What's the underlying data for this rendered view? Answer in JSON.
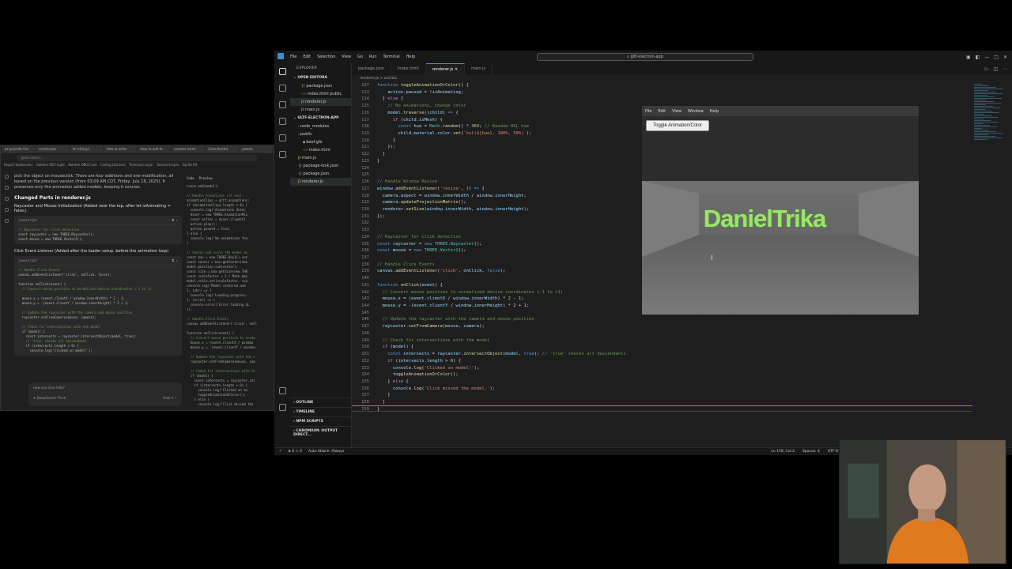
{
  "browser": {
    "tabs": [
      "pt-(p)cklab Cre",
      "constructor",
      "ltc-o(fo)(p)",
      "How to write",
      "How to add th",
      "useeter to(lo)",
      "Calendar(fo)",
      "pwerlo"
    ],
    "url": "grok.com/c/...",
    "bookmarks": [
      "Import bookmarks",
      "Ableton DEV Light",
      "Ableton DBG2 Inst",
      "Coding Libraries",
      "Technical Layer",
      "Tutorial Inspec",
      "Sprite Kit"
    ]
  },
  "chat": {
    "intro": "pick the object on mouseclick. There are four additions and one modification, all based on the previous version (from 03:09 AM CDT, Friday, July 18, 2025). It preserves only the animation added models, keeping it concise.",
    "heading": "Changed Parts in renderer.js",
    "bullet1": "Raycaster and Mouse Initialization (Added near the top, after let isAnimating = false;)",
    "code1_lang": "javascript",
    "code1_lines": [
      "// Raycaster for click detection",
      "const raycaster = new THREE.Raycaster();",
      "const mouse = new THREE.Vector2();"
    ],
    "bullet2": "Click Event Listener (Added after the loader setup, before the animation loop)",
    "code2_lang": "javascript",
    "code2_lines": [
      "// Handle Click Events",
      "canvas.addEventListener('click', onClick, false);",
      "",
      "function onClick(event) {",
      "  // Convert mouse position to normalized device coordinates (-1 to 1)",
      "",
      "  mouse.x = (event.clientX / window.innerWidth) * 2 - 1;",
      "  mouse.y = -(event.clientY / window.innerHeight) * 2 + 1;",
      "",
      "  // Update the raycaster with the camera and mouse position",
      "  raycaster.setFromCamera(mouse, camera);",
      "",
      "  // Check for intersections with the model",
      "  if (model) {",
      "    const intersects = raycaster.intersectObject(model, true);",
      "    // 'true' checks all descendants",
      "    if (intersects.length > 0) {",
      "      console.log('Clicked on model!');"
    ],
    "input_placeholder": "How can Grok help?",
    "deepsearch": "DeepSearch",
    "think": "Think",
    "model": "Grok 3"
  },
  "canvas_pane": {
    "tabs": [
      "Code",
      "Preview"
    ],
    "lines": [
      "scene.add(model);",
      "",
      "// Handle Animations (if any)",
      "animationClips = gltf.animations;",
      "if (animationClips.length > 0) {",
      "  console.log('Animations detec",
      "  mixer = new THREE.AnimationMix",
      "  const action = mixer.clipActi",
      "  action.play();",
      "  action.paused = true;",
      "} else {",
      "  console.log('No animations fou",
      "}",
      "",
      "// Center and scale the model as",
      "const box = new THREE.Box3().set",
      "const center = box.getCenter(new",
      "model.position.sub(center);",
      "const size = box.getSize(new THR",
      "const scaleFactor = 2 / Math.max",
      "model.scale.set(scaleFactor, sca",
      "console.log('Model centered and",
      "}, (xhr) => {",
      "  console.log('Loading progress:",
      "}, (error) => {",
      "  console.error('Error loading GL",
      "});",
      "",
      "// Handle Click Events",
      "canvas.addEventListener('click', onCl",
      "",
      "function onClick(event) {",
      "  // Convert mouse position to norma",
      "  mouse.x = (event.clientX / window",
      "  mouse.y = -(event.clientY / window",
      "",
      "  // Update the raycaster with the c",
      "  raycaster.setFromCamera(mouse, cam",
      "",
      "  // Check for intersections with th",
      "  if (model) {",
      "    const intersects = raycaster.int",
      "    if (intersects.length > 0) {",
      "      console.log('Clicked on mo",
      "      toggleAnimationOrColor();",
      "    } else {",
      "      console.log('Click missed the"
    ]
  },
  "vscode": {
    "menu": [
      "File",
      "Edit",
      "Selection",
      "View",
      "Go",
      "Run",
      "Terminal",
      "Help"
    ],
    "search": "gltf-electron-app",
    "explorer_title": "EXPLORER",
    "open_editors_title": "OPEN EDITORS",
    "open_editors": [
      {
        "name": "package.json",
        "type": "json"
      },
      {
        "name": "index.html public",
        "type": "html"
      },
      {
        "name": "renderer.js",
        "type": "js"
      },
      {
        "name": "main.js",
        "type": "js"
      }
    ],
    "project_title": "GLTF-ELECTRON-APP",
    "tree": [
      {
        "name": "node_modules",
        "type": "dir",
        "indent": 1
      },
      {
        "name": "public",
        "type": "dir",
        "indent": 1
      },
      {
        "name": "beef.glb",
        "type": "file",
        "indent": 2
      },
      {
        "name": "index.html",
        "type": "html",
        "indent": 2
      },
      {
        "name": "main.js",
        "type": "js",
        "indent": 1
      },
      {
        "name": "package-lock.json",
        "type": "json",
        "indent": 1
      },
      {
        "name": "package.json",
        "type": "json",
        "indent": 1
      },
      {
        "name": "renderer.js",
        "type": "js",
        "indent": 1
      }
    ],
    "bottom_sections": [
      "OUTLINE",
      "TIMELINE",
      "NPM SCRIPTS",
      "CHROMIUM: OUTPUT DIRECT..."
    ],
    "tabs": [
      "package.json",
      "index.html",
      "renderer.js",
      "main.js"
    ],
    "active_tab": "renderer.js",
    "breadcrumb": "renderer.js > onClick",
    "status_left": "Auto Attach: Always",
    "status_right": [
      "Ln 159, Col 2",
      "Spaces: 4",
      "UTF-8"
    ]
  },
  "code_lines": [
    {
      "n": "107",
      "html": "<span class=\"kw\">function</span> <span class=\"fn\">toggleAnimationOrColor</span>() {"
    },
    {
      "n": "113",
      "html": "    <span class=\"var\">action</span>.<span class=\"var\">paused</span> = !<span class=\"var\">isAnimating</span>;"
    },
    {
      "n": "114",
      "html": "  } <span class=\"ctl\">else</span> {"
    },
    {
      "n": "115",
      "html": "    <span class=\"cmt\">// No animations, change color</span>"
    },
    {
      "n": "116",
      "html": "    <span class=\"var\">model</span>.<span class=\"fn\">traverse</span>((<span class=\"var\">child</span>) <span class=\"kw\">=&gt;</span> {"
    },
    {
      "n": "117",
      "html": "      <span class=\"ctl\">if</span> (<span class=\"var\">child</span>.<span class=\"var\">isMesh</span>) {"
    },
    {
      "n": "118",
      "html": "        <span class=\"kw\">const</span> <span class=\"var\">hue</span> = <span class=\"cls\">Math</span>.<span class=\"fn\">random</span>() * <span class=\"num\">360</span>; <span class=\"cmt\">// Random HSL hue</span>"
    },
    {
      "n": "119",
      "html": "        <span class=\"var\">child</span>.<span class=\"var\">material</span>.<span class=\"var\">color</span>.<span class=\"fn\">set</span>(<span class=\"str\">`hsl(${hue}, 100%, 50%)`</span>);"
    },
    {
      "n": "120",
      "html": "      }"
    },
    {
      "n": "121",
      "html": "    });"
    },
    {
      "n": "122",
      "html": "  }"
    },
    {
      "n": "123",
      "html": "}"
    },
    {
      "n": "124",
      "html": ""
    },
    {
      "n": "125",
      "html": ""
    },
    {
      "n": "126",
      "html": "<span class=\"cmt\">// Handle Window Resize</span>"
    },
    {
      "n": "127",
      "html": "<span class=\"var\">window</span>.<span class=\"fn\">addEventListener</span>(<span class=\"str\">'resize'</span>, () <span class=\"kw\">=&gt;</span> {"
    },
    {
      "n": "128",
      "html": "  <span class=\"var\">camera</span>.<span class=\"var\">aspect</span> = <span class=\"var\">window</span>.<span class=\"var\">innerWidth</span> / <span class=\"var\">window</span>.<span class=\"var\">innerHeight</span>;"
    },
    {
      "n": "129",
      "html": "  <span class=\"var\">camera</span>.<span class=\"fn\">updateProjectionMatrix</span>();"
    },
    {
      "n": "130",
      "html": "  <span class=\"var\">renderer</span>.<span class=\"fn\">setSize</span>(<span class=\"var\">window</span>.<span class=\"var\">innerWidth</span>, <span class=\"var\">window</span>.<span class=\"var\">innerHeight</span>);"
    },
    {
      "n": "131",
      "html": "});"
    },
    {
      "n": "132",
      "html": ""
    },
    {
      "n": "133",
      "html": ""
    },
    {
      "n": "134",
      "html": "<span class=\"cmt\">// Raycaster for click detection</span>"
    },
    {
      "n": "135",
      "html": "<span class=\"kw\">const</span> <span class=\"var\">raycaster</span> = <span class=\"kw\">new</span> <span class=\"cls\">THREE</span>.<span class=\"cls\">Raycaster</span>();"
    },
    {
      "n": "136",
      "html": "<span class=\"kw\">const</span> <span class=\"var\">mouse</span> = <span class=\"kw\">new</span> <span class=\"cls\">THREE</span>.<span class=\"cls\">Vector2</span>();"
    },
    {
      "n": "137",
      "html": ""
    },
    {
      "n": "138",
      "html": "<span class=\"cmt\">// Handle Click Events</span>"
    },
    {
      "n": "139",
      "html": "<span class=\"var\">canvas</span>.<span class=\"fn\">addEventListener</span>(<span class=\"str\">'click'</span>, <span class=\"var\">onClick</span>, <span class=\"kw\">false</span>);"
    },
    {
      "n": "140",
      "html": ""
    },
    {
      "n": "141",
      "html": "<span class=\"kw\">function</span> <span class=\"fn\">onClick</span>(<span class=\"var\">event</span>) {"
    },
    {
      "n": "142",
      "html": "  <span class=\"cmt\">// Convert mouse position to normalized device coordinates (-1 to +1)</span>"
    },
    {
      "n": "143",
      "html": "  <span class=\"var\">mouse</span>.<span class=\"var\">x</span> = (<span class=\"var\">event</span>.<span class=\"var\">clientX</span> / <span class=\"var\">window</span>.<span class=\"var\">innerWidth</span>) * <span class=\"num\">2</span> - <span class=\"num\">1</span>;"
    },
    {
      "n": "144",
      "html": "  <span class=\"var\">mouse</span>.<span class=\"var\">y</span> = -(<span class=\"var\">event</span>.<span class=\"var\">clientY</span> / <span class=\"var\">window</span>.<span class=\"var\">innerHeight</span>) * <span class=\"num\">2</span> + <span class=\"num\">1</span>;"
    },
    {
      "n": "145",
      "html": ""
    },
    {
      "n": "146",
      "html": "  <span class=\"cmt\">// Update the raycaster with the camera and mouse position</span>"
    },
    {
      "n": "147",
      "html": "  <span class=\"var\">raycaster</span>.<span class=\"fn\">setFromCamera</span>(<span class=\"var\">mouse</span>, <span class=\"var\">camera</span>);"
    },
    {
      "n": "148",
      "html": ""
    },
    {
      "n": "149",
      "html": "  <span class=\"cmt\">// Check for intersections with the model</span>"
    },
    {
      "n": "150",
      "html": "  <span class=\"ctl\">if</span> (<span class=\"var\">model</span>) {"
    },
    {
      "n": "151",
      "html": "    <span class=\"kw\">const</span> <span class=\"var\">intersects</span> = <span class=\"var\">raycaster</span>.<span class=\"fn\">intersectObject</span>(<span class=\"var\">model</span>, <span class=\"kw\">true</span>); <span class=\"cmt\">// 'true' checks all descendants</span>"
    },
    {
      "n": "152",
      "html": "    <span class=\"ctl\">if</span> (<span class=\"var\">intersects</span>.<span class=\"var\">length</span> &gt; <span class=\"num\">0</span>) {"
    },
    {
      "n": "153",
      "html": "      <span class=\"var\">console</span>.<span class=\"fn\">log</span>(<span class=\"str\">'Clicked on model!'</span>);"
    },
    {
      "n": "154",
      "html": "      <span class=\"fn\">toggleAnimationOrColor</span>();"
    },
    {
      "n": "155",
      "html": "    } <span class=\"ctl\">else</span> {"
    },
    {
      "n": "156",
      "html": "      <span class=\"var\">console</span>.<span class=\"fn\">log</span>(<span class=\"str\">'Click missed the model.'</span>);"
    },
    {
      "n": "157",
      "html": "    }"
    },
    {
      "n": "158",
      "html": "  }"
    },
    {
      "n": "159",
      "html": "}"
    }
  ],
  "app_window": {
    "menu": [
      "File",
      "Edit",
      "View",
      "Window",
      "Help"
    ],
    "button": "Toggle Animation/Color",
    "scene_text": "DanielTrika"
  },
  "colors": {
    "accent": "#3b8bd9",
    "scene_text": "#9be56a",
    "editor_bg": "#1e1e1e"
  }
}
